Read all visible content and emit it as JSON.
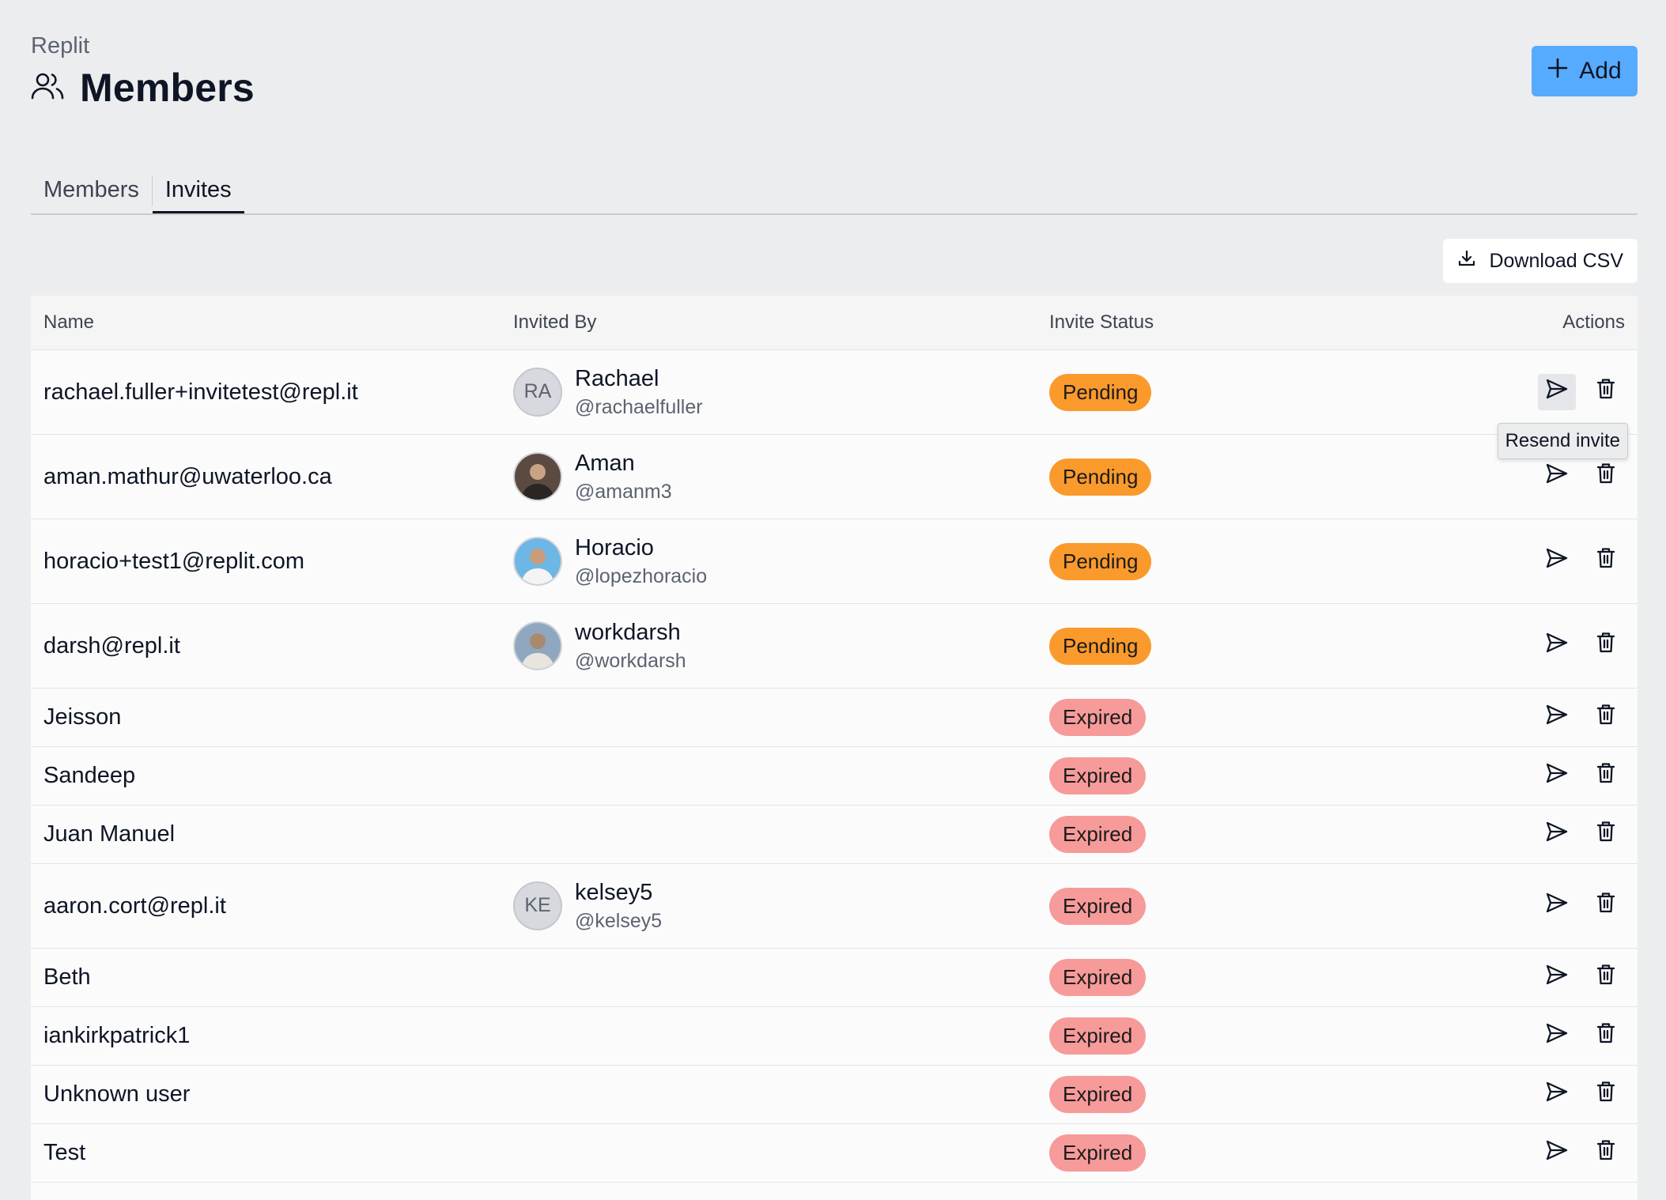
{
  "breadcrumb": "Replit",
  "page": {
    "title": "Members",
    "title_icon": "users-icon",
    "add_button": "Add",
    "add_icon": "plus-icon"
  },
  "tabs": [
    {
      "label": "Members",
      "active": false
    },
    {
      "label": "Invites",
      "active": true
    }
  ],
  "download_csv": {
    "label": "Download CSV",
    "icon": "download-icon"
  },
  "table": {
    "headers": {
      "name": "Name",
      "invited_by": "Invited By",
      "status": "Invite Status",
      "actions": "Actions"
    },
    "rows": [
      {
        "name": "rachael.fuller+invitetest@repl.it",
        "inviter": {
          "name": "Rachael",
          "handle": "@rachaelfuller",
          "initials": "RA",
          "photo": false
        },
        "status": "Pending"
      },
      {
        "name": "aman.mathur@uwaterloo.ca",
        "inviter": {
          "name": "Aman",
          "handle": "@amanm3",
          "initials": "",
          "photo": true
        },
        "status": "Pending"
      },
      {
        "name": "horacio+test1@replit.com",
        "inviter": {
          "name": "Horacio",
          "handle": "@lopezhoracio",
          "initials": "",
          "photo": true
        },
        "status": "Pending"
      },
      {
        "name": "darsh@repl.it",
        "inviter": {
          "name": "workdarsh",
          "handle": "@workdarsh",
          "initials": "",
          "photo": true
        },
        "status": "Pending"
      },
      {
        "name": "Jeisson",
        "inviter": null,
        "status": "Expired"
      },
      {
        "name": "Sandeep",
        "inviter": null,
        "status": "Expired"
      },
      {
        "name": "Juan Manuel",
        "inviter": null,
        "status": "Expired"
      },
      {
        "name": "aaron.cort@repl.it",
        "inviter": {
          "name": "kelsey5",
          "handle": "@kelsey5",
          "initials": "KE",
          "photo": false
        },
        "status": "Expired"
      },
      {
        "name": "Beth",
        "inviter": null,
        "status": "Expired"
      },
      {
        "name": "iankirkpatrick1",
        "inviter": null,
        "status": "Expired"
      },
      {
        "name": "Unknown user",
        "inviter": null,
        "status": "Expired"
      },
      {
        "name": "Test",
        "inviter": null,
        "status": "Expired"
      }
    ],
    "row_actions": [
      "send-icon",
      "trash-icon"
    ]
  },
  "tooltip": "Resend invite",
  "colors": {
    "background": "#ecedef",
    "accent": "#57abff",
    "pending": "#fb9a2c",
    "expired": "#f79a9a"
  }
}
